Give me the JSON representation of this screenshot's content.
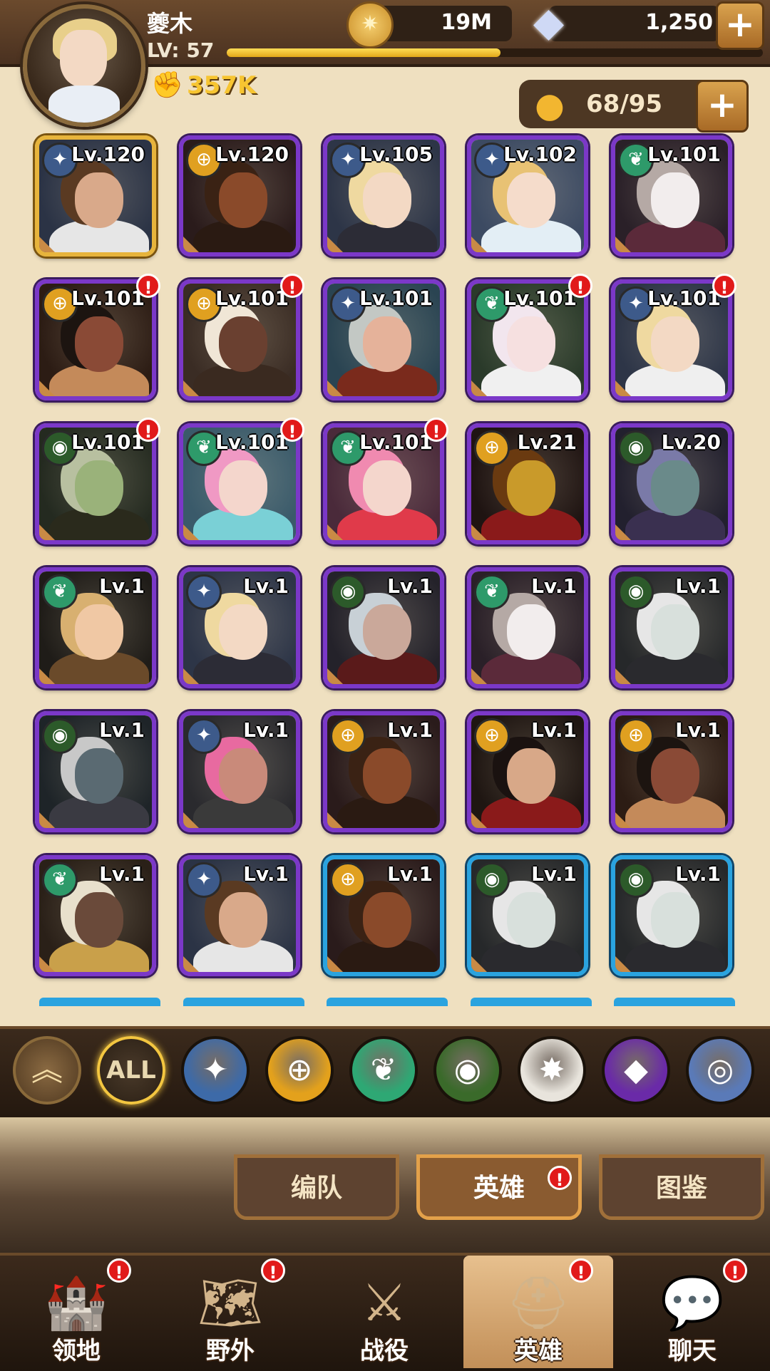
{
  "player": {
    "name": "夔木",
    "level_label": "LV:",
    "level": "57",
    "xp_progress": 0.51,
    "power": "357K"
  },
  "resources": {
    "gold": "19M",
    "diamonds": "1,250",
    "roster": "68/95"
  },
  "icons": {
    "gold": "coin-icon",
    "diamond": "diamond-icon",
    "roster": "person-icon",
    "power": "fist-icon",
    "plus": "plus-icon"
  },
  "heroes": [
    {
      "level": "Lv.120",
      "faction": "lightbearer",
      "frame": "gold",
      "alert": false,
      "skin": "#d9a98a",
      "outfit": "#e6e6e6",
      "hair": "#5a3a22",
      "bg": "#2b3345"
    },
    {
      "level": "Lv.120",
      "faction": "mauler",
      "frame": "purple",
      "alert": false,
      "skin": "#8a4a2a",
      "outfit": "#2a1a12",
      "hair": "#3a2214",
      "bg": "#2a1b1b"
    },
    {
      "level": "Lv.105",
      "faction": "lightbearer",
      "frame": "purple",
      "alert": false,
      "skin": "#f3d9c4",
      "outfit": "#2c2c36",
      "hair": "#efd9a0",
      "bg": "#2d3547"
    },
    {
      "level": "Lv.102",
      "faction": "lightbearer",
      "frame": "purple",
      "alert": false,
      "skin": "#f5dccb",
      "outfit": "#e3eef5",
      "hair": "#e8c274",
      "bg": "#3c4a62"
    },
    {
      "level": "Lv.101",
      "faction": "wilder",
      "frame": "purple",
      "alert": false,
      "skin": "#f2eded",
      "outfit": "#5b2a3a",
      "hair": "#b5a9a5",
      "bg": "#2a2028"
    },
    {
      "level": "Lv.101",
      "faction": "mauler",
      "frame": "purple",
      "alert": true,
      "skin": "#8a4a36",
      "outfit": "#c48a5a",
      "hair": "#1c1410",
      "bg": "#2c1c14"
    },
    {
      "level": "Lv.101",
      "faction": "mauler",
      "frame": "purple",
      "alert": true,
      "skin": "#6a4030",
      "outfit": "#3a2a20",
      "hair": "#f0e6d6",
      "bg": "#3a2c24"
    },
    {
      "level": "Lv.101",
      "faction": "lightbearer",
      "frame": "purple",
      "alert": false,
      "skin": "#e5b29a",
      "outfit": "#7a2a1c",
      "hair": "#c3c8c4",
      "bg": "#2a4452"
    },
    {
      "level": "Lv.101",
      "faction": "wilder",
      "frame": "purple",
      "alert": true,
      "skin": "#f6e0e0",
      "outfit": "#f0f0f0",
      "hair": "#f2e6ee",
      "bg": "#2a3a2a"
    },
    {
      "level": "Lv.101",
      "faction": "lightbearer",
      "frame": "purple",
      "alert": true,
      "skin": "#f3d9c4",
      "outfit": "#efefef",
      "hair": "#efd9a0",
      "bg": "#2d3547"
    },
    {
      "level": "Lv.101",
      "faction": "graveborn",
      "frame": "purple",
      "alert": true,
      "skin": "#9ab27a",
      "outfit": "#2a2a1c",
      "hair": "#b8c0a0",
      "bg": "#242a20"
    },
    {
      "level": "Lv.101",
      "faction": "wilder",
      "frame": "purple",
      "alert": true,
      "skin": "#f4d6cc",
      "outfit": "#7ad0d6",
      "hair": "#f099c4",
      "bg": "#3a5a6a"
    },
    {
      "level": "Lv.101",
      "faction": "wilder",
      "frame": "purple",
      "alert": true,
      "skin": "#f4d6cc",
      "outfit": "#e03a4a",
      "hair": "#f08ab0",
      "bg": "#4a2a3a"
    },
    {
      "level": "Lv.21",
      "faction": "mauler",
      "frame": "purple",
      "alert": false,
      "skin": "#c99a2a",
      "outfit": "#8a1a1a",
      "hair": "#6a3a10",
      "bg": "#1f1412"
    },
    {
      "level": "Lv.20",
      "faction": "graveborn",
      "frame": "purple",
      "alert": false,
      "skin": "#6a8a8a",
      "outfit": "#3a3050",
      "hair": "#7a7aa8",
      "bg": "#22202e"
    },
    {
      "level": "Lv.1",
      "faction": "wilder",
      "frame": "purple",
      "alert": false,
      "skin": "#f0c8a4",
      "outfit": "#6a4a2a",
      "hair": "#d8b070",
      "bg": "#1f1c18"
    },
    {
      "level": "Lv.1",
      "faction": "lightbearer",
      "frame": "purple",
      "alert": false,
      "skin": "#f3d9c4",
      "outfit": "#2c2c36",
      "hair": "#efd9a0",
      "bg": "#2d3547"
    },
    {
      "level": "Lv.1",
      "faction": "graveborn",
      "frame": "purple",
      "alert": false,
      "skin": "#caa89a",
      "outfit": "#5a1a1a",
      "hair": "#c8d0d6",
      "bg": "#24222a"
    },
    {
      "level": "Lv.1",
      "faction": "wilder",
      "frame": "purple",
      "alert": false,
      "skin": "#f2eded",
      "outfit": "#5b2a3a",
      "hair": "#b5a9a5",
      "bg": "#2a2028"
    },
    {
      "level": "Lv.1",
      "faction": "graveborn",
      "frame": "purple",
      "alert": false,
      "skin": "#d8e0dc",
      "outfit": "#2a2a2e",
      "hair": "#e6e6e6",
      "bg": "#26282a"
    },
    {
      "level": "Lv.1",
      "faction": "graveborn",
      "frame": "purple",
      "alert": false,
      "skin": "#5a6a72",
      "outfit": "#3a3a42",
      "hair": "#c8c8c8",
      "bg": "#1e2428"
    },
    {
      "level": "Lv.1",
      "faction": "lightbearer",
      "frame": "purple",
      "alert": false,
      "skin": "#c98a7a",
      "outfit": "#3a3a3a",
      "hair": "#e86aa0",
      "bg": "#2a2a2e"
    },
    {
      "level": "Lv.1",
      "faction": "mauler",
      "frame": "purple",
      "alert": false,
      "skin": "#8a4a2a",
      "outfit": "#2a1a12",
      "hair": "#3a2214",
      "bg": "#2a1b1b"
    },
    {
      "level": "Lv.1",
      "faction": "mauler",
      "frame": "purple",
      "alert": false,
      "skin": "#d8a888",
      "outfit": "#8a1a1a",
      "hair": "#1a1210",
      "bg": "#1f1612"
    },
    {
      "level": "Lv.1",
      "faction": "mauler",
      "frame": "purple",
      "alert": false,
      "skin": "#8a4a36",
      "outfit": "#c48a5a",
      "hair": "#1c1410",
      "bg": "#2c1c14"
    },
    {
      "level": "Lv.1",
      "faction": "wilder",
      "frame": "purple",
      "alert": false,
      "skin": "#6a4a3a",
      "outfit": "#c9a04a",
      "hair": "#e8e0cc",
      "bg": "#2a2018"
    },
    {
      "level": "Lv.1",
      "faction": "lightbearer",
      "frame": "purple",
      "alert": false,
      "skin": "#d9a98a",
      "outfit": "#e6e6e6",
      "hair": "#5a3a22",
      "bg": "#2b3345"
    },
    {
      "level": "Lv.1",
      "faction": "mauler",
      "frame": "blue",
      "alert": false,
      "skin": "#8a4a2a",
      "outfit": "#2a1a12",
      "hair": "#3a2214",
      "bg": "#2a1b1b"
    },
    {
      "level": "Lv.1",
      "faction": "graveborn",
      "frame": "blue",
      "alert": false,
      "skin": "#d8e0dc",
      "outfit": "#2a2a2e",
      "hair": "#e6e6e6",
      "bg": "#26282a"
    },
    {
      "level": "Lv.1",
      "faction": "graveborn",
      "frame": "blue",
      "alert": false,
      "skin": "#d8e0dc",
      "outfit": "#2a2a2e",
      "hair": "#e6e6e6",
      "bg": "#26282a"
    }
  ],
  "faction_styles": {
    "lightbearer": {
      "bg": "#3d5a8a",
      "glyph": "✦",
      "icon": "lightbearer-icon"
    },
    "mauler": {
      "bg": "#e0a020",
      "glyph": "⊕",
      "icon": "mauler-icon"
    },
    "wilder": {
      "bg": "#2e9a6a",
      "glyph": "❦",
      "icon": "wilder-icon"
    },
    "graveborn": {
      "bg": "#2c5a2a",
      "glyph": "◉",
      "icon": "graveborn-icon"
    }
  },
  "filters": [
    {
      "icon": "chevron-up-icon",
      "label": "︽",
      "style": "up"
    },
    {
      "icon": "all-icon",
      "label": "ALL",
      "style": "all"
    },
    {
      "icon": "lightbearer-icon",
      "label": "✦",
      "bg": "#3d6aa8"
    },
    {
      "icon": "mauler-icon",
      "label": "⊕",
      "bg": "#e3a11c"
    },
    {
      "icon": "wilder-icon",
      "label": "❦",
      "bg": "#2ea874"
    },
    {
      "icon": "graveborn-icon",
      "label": "◉",
      "bg": "#3a6a2a"
    },
    {
      "icon": "celestial-icon",
      "label": "✸",
      "bg": "#e8e4dc"
    },
    {
      "icon": "hypogean-icon",
      "label": "◆",
      "bg": "#6a2aa8"
    },
    {
      "icon": "dimensional-icon",
      "label": "◎",
      "bg": "#5a7ab8"
    }
  ],
  "subtabs": [
    {
      "label": "编队",
      "active": false,
      "alert": false
    },
    {
      "label": "英雄",
      "active": true,
      "alert": true
    },
    {
      "label": "图鉴",
      "active": false,
      "alert": false
    }
  ],
  "nav": [
    {
      "label": "领地",
      "icon": "castle-icon",
      "glyph": "🏰",
      "active": false,
      "alert": true
    },
    {
      "label": "野外",
      "icon": "map-scroll-icon",
      "glyph": "🗺",
      "active": false,
      "alert": true
    },
    {
      "label": "战役",
      "icon": "sword-shield-icon",
      "glyph": "⚔",
      "active": false,
      "alert": false
    },
    {
      "label": "英雄",
      "icon": "hero-helmet-icon",
      "glyph": "⛑",
      "active": true,
      "alert": true
    },
    {
      "label": "聊天",
      "icon": "chat-bubble-icon",
      "glyph": "💬",
      "active": false,
      "alert": true
    }
  ],
  "alert_glyph": "!"
}
